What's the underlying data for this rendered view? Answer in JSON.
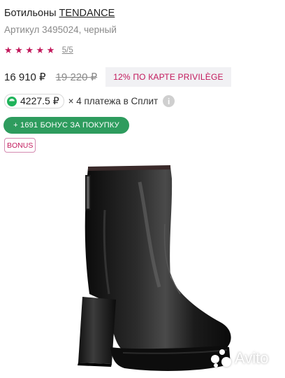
{
  "product": {
    "type_label": "Ботильоны",
    "brand": "TENDANCE",
    "subtitle": "Артикул 3495024, черный"
  },
  "rating": {
    "stars_filled": 5,
    "value_text": "5/5"
  },
  "pricing": {
    "price": "16 910 ₽",
    "old_price": "19 220 ₽",
    "privilege_label": "12% ПО КАРТЕ PRIVILÈGE"
  },
  "split": {
    "amount": "4227.5 ₽",
    "text": "× 4 платежа в Сплит",
    "info_icon_glyph": "i"
  },
  "bonus": {
    "button_label": "+ 1691 БОНУС ЗА ПОКУПКУ",
    "tag_label": "BONUS"
  },
  "watermark": {
    "text": "Avito"
  },
  "colors": {
    "accent_pink": "#c2185b",
    "bonus_green": "#2e9c5e",
    "split_green": "#1fb35a",
    "privilege_bg": "#f1f1f4"
  },
  "icons": {
    "rating": "star-icon",
    "split": "split-logo-icon",
    "info": "info-icon",
    "watermark": "avito-logo-icon"
  }
}
